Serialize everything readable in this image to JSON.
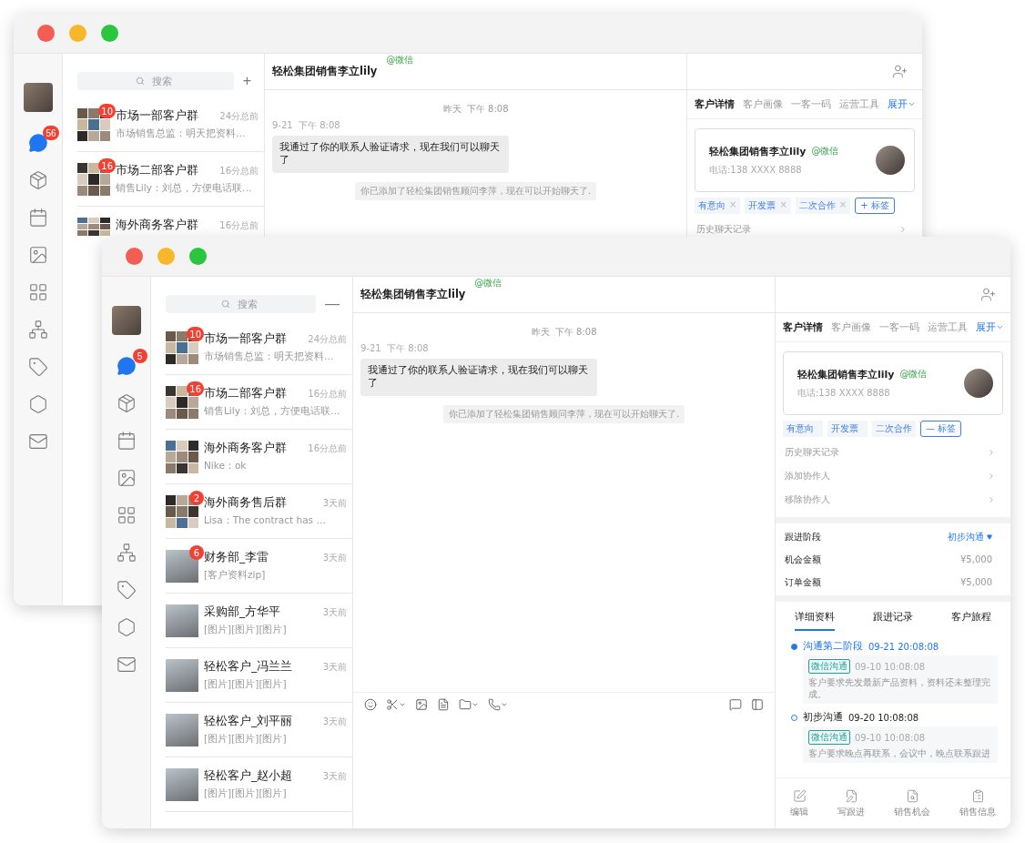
{
  "windows": [
    {
      "nav": [
        {
          "kind": "chat",
          "selected": true,
          "badge": "56"
        },
        {
          "kind": "box",
          "selected": false
        },
        {
          "kind": "calendar",
          "selected": false
        },
        {
          "kind": "image",
          "selected": false
        },
        {
          "kind": "grid",
          "selected": false
        },
        {
          "kind": "org",
          "selected": false
        },
        {
          "kind": "tag",
          "selected": false
        },
        {
          "kind": "hexagon",
          "selected": false
        },
        {
          "kind": "mail",
          "selected": false
        }
      ],
      "search": {
        "placeholder": "搜索"
      },
      "list_action": "+",
      "conversations": [
        {
          "kind": "group",
          "badge": "10",
          "title": "市场一部客户群",
          "time": "24分总前",
          "preview": "市场销售总监：明天把资料…"
        },
        {
          "kind": "group",
          "badge": "16",
          "title": "市场二部客户群",
          "time": "16分总前",
          "preview": "销售Lily：刘总，方便电话联…"
        },
        {
          "kind": "group",
          "title": "海外商务客户群",
          "time": "16分总前"
        }
      ],
      "chat": {
        "contact": "轻松集团销售李立lily",
        "channel": "@微信",
        "divider": "昨天  下午 8:08",
        "messages": [
          {
            "kind": "incoming",
            "meta": "9-21  下午 8:08",
            "text": "我通过了你的联系人验证请求，现在我们可以聊天了"
          },
          {
            "kind": "system",
            "text": "你已添加了轻松集团销售顾问李萍，现在可以开始聊天了."
          }
        ]
      },
      "panel": {
        "tabs": [
          {
            "label": "客户详情",
            "selected": true
          },
          {
            "label": "客户画像",
            "selected": false
          },
          {
            "label": "一客一码",
            "selected": false
          },
          {
            "label": "运营工具",
            "selected": false
          }
        ],
        "expand": "展开",
        "card": {
          "name": "轻松集团销售李立lily",
          "channel": "@微信",
          "phone": "电话:138 XXXX 8888"
        },
        "tags": [
          {
            "label": "有意向",
            "remove": "×"
          },
          {
            "label": "开发票",
            "remove": "×"
          },
          {
            "label": "二次合作",
            "remove": "×"
          }
        ],
        "add_tag": "+ 标签",
        "links": [
          "历史聊天记录"
        ]
      }
    },
    {
      "nav": [
        {
          "kind": "chat",
          "selected": true,
          "badge": "5"
        },
        {
          "kind": "box",
          "selected": false
        },
        {
          "kind": "calendar",
          "selected": false
        },
        {
          "kind": "image",
          "selected": false
        },
        {
          "kind": "grid",
          "selected": false
        },
        {
          "kind": "org",
          "selected": false
        },
        {
          "kind": "tag",
          "selected": false
        },
        {
          "kind": "hexagon",
          "selected": false
        },
        {
          "kind": "mail",
          "selected": false
        }
      ],
      "search": {
        "placeholder": "搜索"
      },
      "list_action": "—",
      "conversations": [
        {
          "kind": "group",
          "badge": "10",
          "title": "市场一部客户群",
          "time": "24分总前",
          "preview": "市场销售总监：明天把资料…"
        },
        {
          "kind": "group",
          "badge": "16",
          "title": "市场二部客户群",
          "time": "16分总前",
          "preview": "销售Lily：刘总，方便电话联…"
        },
        {
          "kind": "group",
          "title": "海外商务客户群",
          "time": "16分总前",
          "preview": "Nike：ok"
        },
        {
          "kind": "group",
          "badge": "2",
          "title": "海外商务售后群",
          "time": "3天前",
          "preview": "Lisa：The contract has …"
        },
        {
          "kind": "photo",
          "badge": "6",
          "title": "财务部_李雷",
          "time": "3天前",
          "preview": "[客户资料zip]"
        },
        {
          "kind": "photo",
          "title": "采购部_方华平",
          "time": "3天前",
          "preview": "[图片][图片][图片]"
        },
        {
          "kind": "photo",
          "title": "轻松客户_冯兰兰",
          "time": "3天前",
          "preview": "[图片][图片][图片]"
        },
        {
          "kind": "photo",
          "title": "轻松客户_刘平丽",
          "time": "3天前",
          "preview": "[图片][图片][图片]"
        },
        {
          "kind": "photo",
          "title": "轻松客户_赵小超",
          "time": "3天前",
          "preview": "[图片][图片][图片]"
        }
      ],
      "chat": {
        "contact": "轻松集团销售李立lily",
        "channel": "@微信",
        "divider": "昨天  下午 8:08",
        "messages": [
          {
            "kind": "incoming",
            "meta": "9-21  下午 8:08",
            "text": "我通过了你的联系人验证请求，现在我们可以聊天了"
          },
          {
            "kind": "system",
            "text": "你已添加了轻松集团销售顾问李萍，现在可以开始聊天了."
          }
        ],
        "composer_toolbar": true
      },
      "panel": {
        "tabs": [
          {
            "label": "客户详情",
            "selected": true
          },
          {
            "label": "客户画像",
            "selected": false
          },
          {
            "label": "一客一码",
            "selected": false
          },
          {
            "label": "运营工具",
            "selected": false
          }
        ],
        "expand": "展开",
        "card": {
          "name": "轻松集团销售李立lily",
          "channel": "@微信",
          "phone": "电话:138 XXXX 8888"
        },
        "tags": [
          {
            "label": "有意向"
          },
          {
            "label": "开发票"
          },
          {
            "label": "二次合作"
          }
        ],
        "add_tag": "— 标签",
        "links": [
          "历史聊天记录",
          "添加协作人",
          "移除协作人"
        ],
        "fields": [
          {
            "kind": "select",
            "label": "跟进阶段",
            "value": "初步沟通"
          },
          {
            "kind": "text",
            "label": "机会金额",
            "value": "¥5,000"
          },
          {
            "kind": "text",
            "label": "订单金额",
            "value": "¥5,000"
          }
        ],
        "subtabs": [
          {
            "label": "详细资料",
            "selected": true
          },
          {
            "label": "跟进记录",
            "selected": false
          },
          {
            "label": "客户旅程",
            "selected": false
          }
        ],
        "timeline": [
          {
            "title": "沟通第二阶段",
            "time": "09-21 20:08:08",
            "current": true,
            "channel_tag": "微信沟通",
            "note_time": "09-10 10:08:08",
            "note": "客户要求先发最新产品资料，资料还未整理完成。"
          },
          {
            "title": "初步沟通",
            "time": "09-20 10:08:08",
            "current": false,
            "channel_tag": "微信沟通",
            "note_time": "09-10 10:08:08",
            "note": "客户要求晚点再联系，会议中，晚点联系跟进"
          }
        ],
        "actions": [
          {
            "kind": "edit",
            "label": "编辑"
          },
          {
            "kind": "write",
            "label": "写跟进"
          },
          {
            "kind": "opportunity",
            "label": "销售机会"
          },
          {
            "kind": "info",
            "label": "销售信息"
          }
        ]
      }
    }
  ]
}
